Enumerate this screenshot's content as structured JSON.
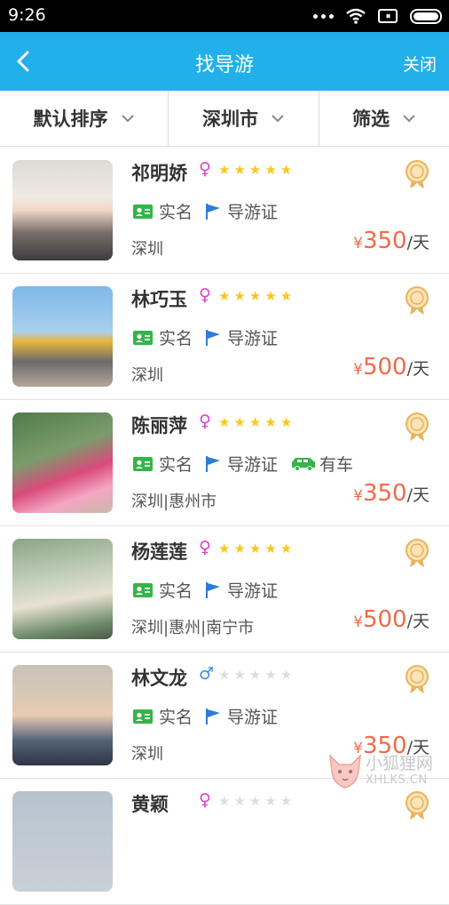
{
  "status_bar": {
    "time": "9:26"
  },
  "header": {
    "title": "找导游",
    "close_label": "关闭"
  },
  "filters": [
    {
      "label": "默认排序"
    },
    {
      "label": "深圳市"
    },
    {
      "label": "筛选"
    }
  ],
  "colors": {
    "accent": "#22b0ea",
    "price": "#ee6b4a",
    "star_on": "#f7c81d",
    "star_off": "#dddddd",
    "female": "#e040c8",
    "male": "#3f8ee0",
    "verified": "#35b449",
    "flag": "#2e7cd8"
  },
  "labels": {
    "real_name": "实名",
    "guide_cert": "导游证",
    "has_car": "有车",
    "currency": "¥",
    "per_day": "/天"
  },
  "guides": [
    {
      "name": "祁明娇",
      "gender": "female",
      "stars": 5,
      "real_name": true,
      "guide_cert": true,
      "has_car": false,
      "cities": "深圳",
      "price": "350"
    },
    {
      "name": "林巧玉",
      "gender": "female",
      "stars": 5,
      "real_name": true,
      "guide_cert": true,
      "has_car": false,
      "cities": "深圳",
      "price": "500"
    },
    {
      "name": "陈丽萍",
      "gender": "female",
      "stars": 5,
      "real_name": true,
      "guide_cert": true,
      "has_car": true,
      "cities": "深圳|惠州市",
      "price": "350"
    },
    {
      "name": "杨莲莲",
      "gender": "female",
      "stars": 5,
      "real_name": true,
      "guide_cert": true,
      "has_car": false,
      "cities": "深圳|惠州|南宁市",
      "price": "500"
    },
    {
      "name": "林文龙",
      "gender": "male",
      "stars": 0,
      "real_name": true,
      "guide_cert": true,
      "has_car": false,
      "cities": "深圳",
      "price": "350"
    },
    {
      "name": "黄颖",
      "gender": "female",
      "stars": 0,
      "real_name": false,
      "guide_cert": false,
      "has_car": false,
      "cities": "",
      "price": ""
    }
  ],
  "watermark": {
    "name": "小狐狸网",
    "url": "XHLKS.CN"
  }
}
